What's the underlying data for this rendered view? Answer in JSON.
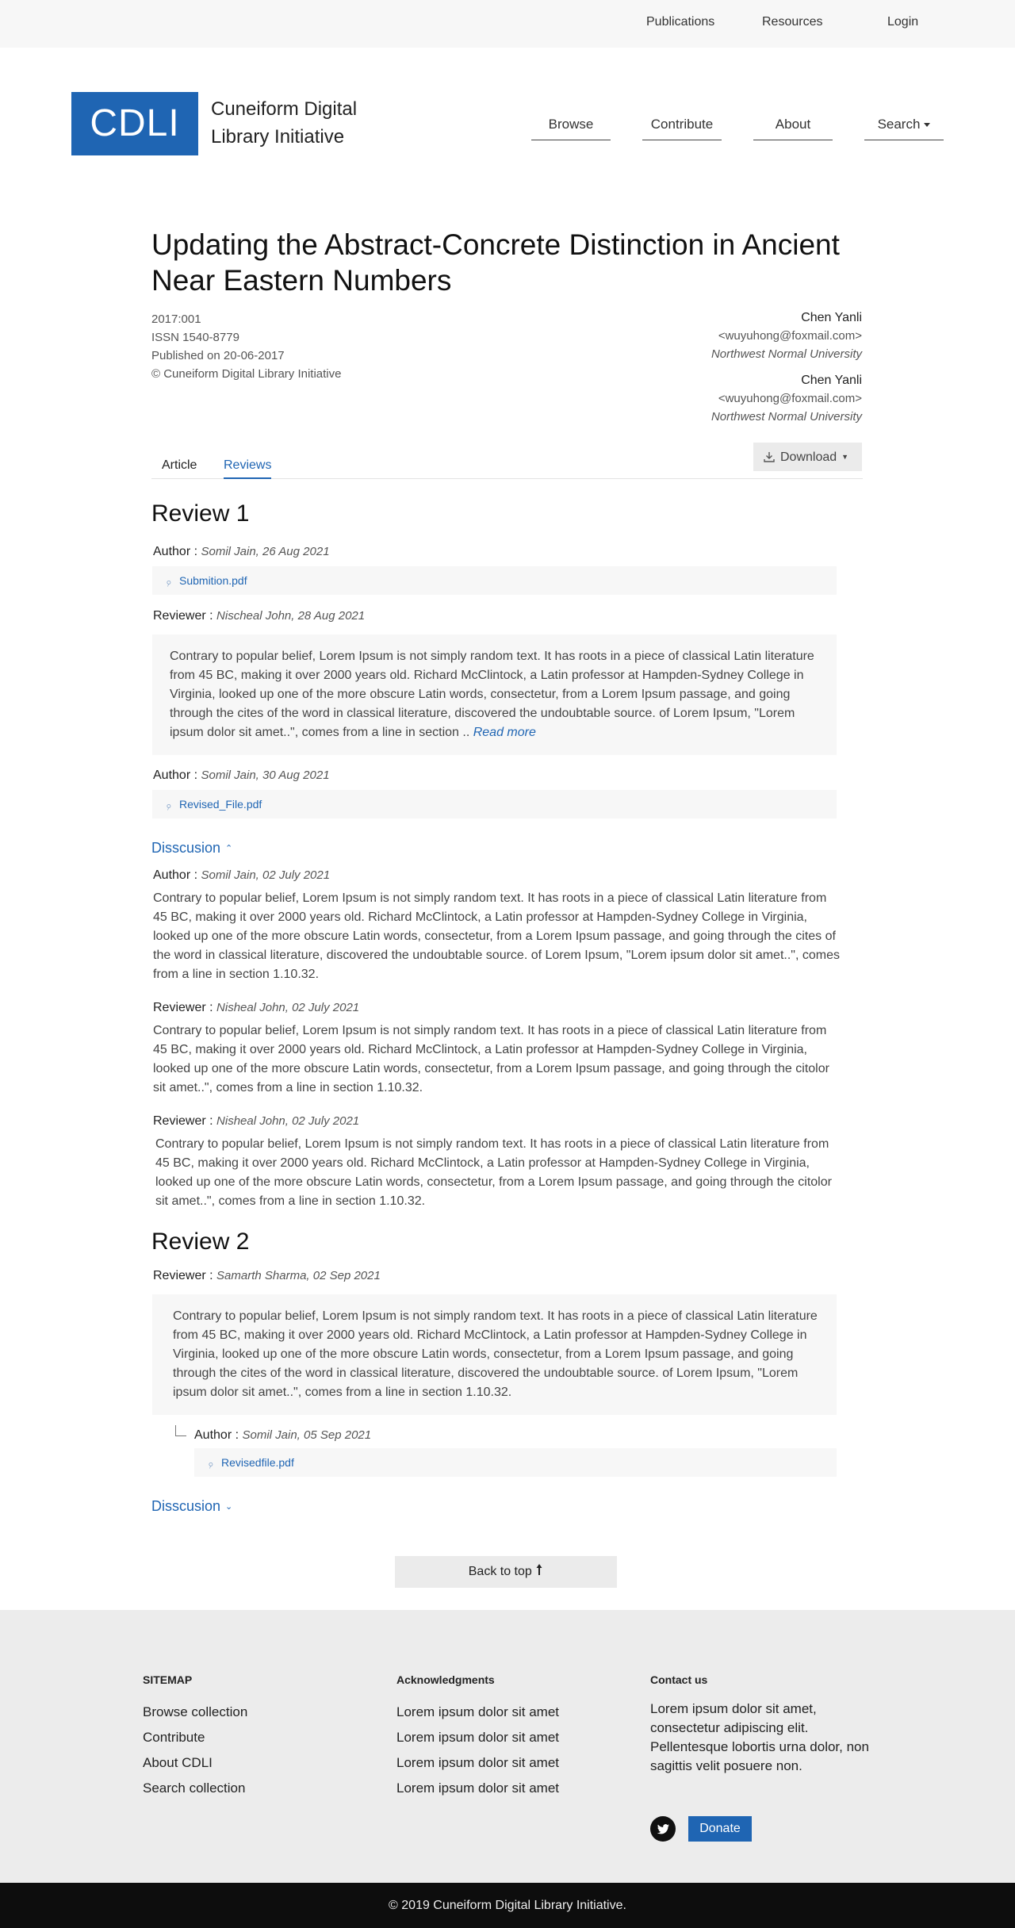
{
  "topbar": {
    "links": [
      "Publications",
      "Resources",
      "Login"
    ]
  },
  "brand": {
    "logo": "CDLI",
    "name_line1": "Cuneiform Digital",
    "name_line2": "Library Initiative"
  },
  "nav": {
    "items": [
      "Browse",
      "Contribute",
      "About",
      "Search"
    ]
  },
  "article": {
    "title": "Updating the Abstract-Concrete Distinction in Ancient Near Eastern Numbers",
    "id": "2017:001",
    "issn": "ISSN 1540-8779",
    "published": "Published on 20-06-2017",
    "copyright": "© Cuneiform Digital Library Initiative",
    "authors": [
      {
        "name": "Chen Yanli",
        "email": "<wuyuhong@foxmail.com>",
        "affiliation": "Northwest Normal University"
      },
      {
        "name": "Chen Yanli",
        "email": "<wuyuhong@foxmail.com>",
        "affiliation": "Northwest Normal University"
      }
    ]
  },
  "tabs": {
    "article": "Article",
    "reviews": "Reviews"
  },
  "download_label": "Download",
  "review1": {
    "heading": "Review 1",
    "author_label": "Author :",
    "reviewer_label": "Reviewer :",
    "entry1_meta": "Somil Jain, 26 Aug 2021",
    "entry1_file": "Submition.pdf",
    "entry2_meta": "Nischeal John, 28 Aug 2021",
    "entry2_text": "Contrary to popular belief, Lorem Ipsum is not simply random text. It has roots in a piece of classical Latin literature from 45 BC, making it over 2000 years old. Richard McClintock, a Latin professor at Hampden-Sydney College in Virginia, looked up one of the more obscure Latin words, consectetur, from a Lorem Ipsum passage, and going through the cites of the word in classical literature, discovered the undoubtable source. of Lorem Ipsum, \"Lorem ipsum dolor sit amet..\", comes from a line in section ..",
    "read_more": "Read more",
    "entry3_meta": "Somil Jain, 30 Aug 2021",
    "entry3_file": "Revised_File.pdf",
    "discussion_label": "Disscusion",
    "discussion": [
      {
        "role": "Author :",
        "meta": "Somil Jain, 02 July 2021",
        "text": "Contrary to popular belief, Lorem Ipsum is not simply random text. It has roots in a piece of classical Latin literature from 45 BC, making it over 2000 years old. Richard McClintock, a Latin professor at Hampden-Sydney College in Virginia, looked up one of the more obscure Latin words, consectetur, from a Lorem Ipsum passage, and going through the cites of the word in classical literature, discovered the undoubtable source. of Lorem Ipsum, \"Lorem ipsum dolor sit amet..\", comes from a line in section 1.10.32."
      },
      {
        "role": "Reviewer :",
        "meta": "Nisheal John, 02 July 2021",
        "text": "Contrary to popular belief, Lorem Ipsum is not simply random text. It has roots in a piece of classical Latin literature from 45 BC, making it over 2000 years old. Richard McClintock, a Latin professor at Hampden-Sydney College in Virginia, looked up one of the more obscure Latin words, consectetur, from a Lorem Ipsum passage, and going through the citolor sit amet..\", comes from a line in section 1.10.32."
      },
      {
        "role": "Reviewer :",
        "meta": "Nisheal John, 02 July 2021",
        "text": "Contrary to popular belief, Lorem Ipsum is not simply random text. It has roots in a piece of classical Latin literature from 45 BC, making it over 2000 years old. Richard McClintock, a Latin professor at Hampden-Sydney College in Virginia, looked up one of the more obscure Latin words, consectetur, from a Lorem Ipsum passage, and going through the citolor sit amet..\", comes from a line in section 1.10.32."
      }
    ]
  },
  "review2": {
    "heading": "Review 2",
    "reviewer_label": "Reviewer :",
    "reviewer_meta": "Samarth Sharma, 02 Sep 2021",
    "reviewer_text": "Contrary to popular belief, Lorem Ipsum is not simply random text. It has roots in a piece of classical Latin literature from 45 BC, making it over 2000 years old. Richard McClintock, a Latin professor at Hampden-Sydney College in Virginia, looked up one of the more obscure Latin words, consectetur, from a Lorem Ipsum passage, and going through the cites of the word in classical literature, discovered the undoubtable source. of Lorem Ipsum, \"Lorem ipsum dolor sit amet..\", comes from a line in section 1.10.32.",
    "author_label": "Author :",
    "author_meta": "Somil Jain, 05 Sep 2021",
    "author_file": "Revisedfile.pdf",
    "discussion_label": "Disscusion"
  },
  "back_to_top": "Back to top",
  "footer": {
    "sitemap_title": "SITEMAP",
    "sitemap": [
      "Browse collection",
      "Contribute",
      "About CDLI",
      "Search collection"
    ],
    "ack_title": "Acknowledgments",
    "ack": [
      "Lorem ipsum dolor sit amet",
      "Lorem ipsum dolor sit amet",
      "Lorem ipsum dolor sit amet",
      "Lorem ipsum dolor sit amet"
    ],
    "contact_title": "Contact us",
    "contact_text": "Lorem ipsum dolor sit amet, consectetur adipiscing elit. Pellentesque lobortis urna dolor, non sagittis velit posuere non.",
    "donate": "Donate",
    "copyright": "© 2019 Cuneiform Digital Library Initiative."
  },
  "colors": {
    "brand": "#1f65b3",
    "footer_bg": "#ececec",
    "bottombar": "#0d0d0d"
  }
}
